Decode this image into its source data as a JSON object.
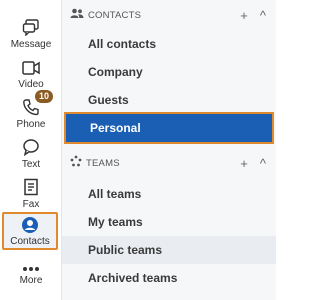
{
  "rail": {
    "items": [
      {
        "label": "Message",
        "icon": "message-icon"
      },
      {
        "label": "Video",
        "icon": "video-icon"
      },
      {
        "label": "Phone",
        "icon": "phone-icon",
        "badge": "10"
      },
      {
        "label": "Text",
        "icon": "text-icon"
      },
      {
        "label": "Fax",
        "icon": "fax-icon"
      },
      {
        "label": "Contacts",
        "icon": "contacts-icon"
      },
      {
        "label": "More",
        "icon": "more-icon"
      }
    ]
  },
  "contacts": {
    "header": "CONTACTS",
    "add_glyph": "+",
    "collapse_glyph": "^",
    "items": [
      "All contacts",
      "Company",
      "Guests",
      "Personal"
    ]
  },
  "teams": {
    "header": "TEAMS",
    "add_glyph": "+",
    "collapse_glyph": "^",
    "items": [
      "All teams",
      "My teams",
      "Public teams",
      "Archived teams"
    ]
  },
  "colors": {
    "accent": "#1b5fb5",
    "highlight_border": "#e08a2e",
    "badge": "#8a5b23"
  }
}
